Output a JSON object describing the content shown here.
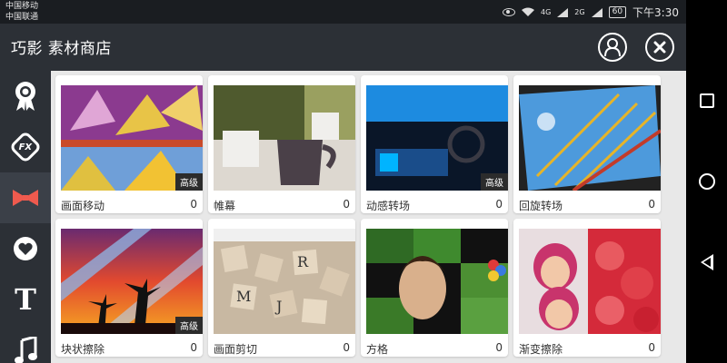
{
  "status_bar": {
    "carrier_1": "中国移动",
    "carrier_2": "中国联通",
    "network_1": "4G",
    "network_2": "2G",
    "battery": "60",
    "time": "下午3:30"
  },
  "header": {
    "title": "巧影 素材商店",
    "account_icon": "account-icon",
    "close_icon": "close-icon"
  },
  "sidebar": {
    "items": [
      {
        "icon": "award-badge-icon",
        "active": false
      },
      {
        "icon": "fx-icon",
        "label": "FX",
        "active": false
      },
      {
        "icon": "bowtie-icon",
        "active": true
      },
      {
        "icon": "sticker-icon",
        "active": false
      },
      {
        "icon": "text-icon",
        "label": "T",
        "active": false
      },
      {
        "icon": "music-icon",
        "active": false
      }
    ]
  },
  "cards": [
    {
      "label": "画面移动",
      "count": "0",
      "badge": "高级"
    },
    {
      "label": "帷幕",
      "count": "0",
      "badge": ""
    },
    {
      "label": "动感转场",
      "count": "0",
      "badge": "高级"
    },
    {
      "label": "回旋转场",
      "count": "0",
      "badge": ""
    },
    {
      "label": "块状擦除",
      "count": "0",
      "badge": "高级"
    },
    {
      "label": "画面剪切",
      "count": "0",
      "badge": ""
    },
    {
      "label": "方格",
      "count": "0",
      "badge": ""
    },
    {
      "label": "渐变擦除",
      "count": "0",
      "badge": ""
    }
  ],
  "colors": {
    "accent": "#ef5a4e",
    "panel": "#2c3036",
    "content_bg": "#e8e8e8"
  }
}
